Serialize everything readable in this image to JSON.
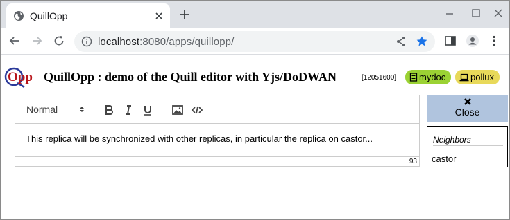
{
  "browser": {
    "tab_title": "QuillOpp",
    "url_host": "localhost",
    "url_rest": ":8080/apps/quillopp/"
  },
  "app": {
    "logo_text": "Opp",
    "title": "QuillOpp : demo of the Quill editor with Yjs/DoDWAN",
    "version": "[12051600]",
    "doc_badge": "mydoc",
    "host_badge": "pollux"
  },
  "editor": {
    "header_select": "Normal",
    "content": "This replica will be synchronized with other replicas, in particular the replica on castor...",
    "char_count": "93"
  },
  "close_button": {
    "label": "Close"
  },
  "neighbors": {
    "title": "Neighbors",
    "items": [
      "castor"
    ]
  },
  "colors": {
    "doc_badge": "#9bd234",
    "host_badge": "#e8d95a",
    "close_button": "#b0c4de",
    "bookmark_star": "#1a73e8"
  }
}
